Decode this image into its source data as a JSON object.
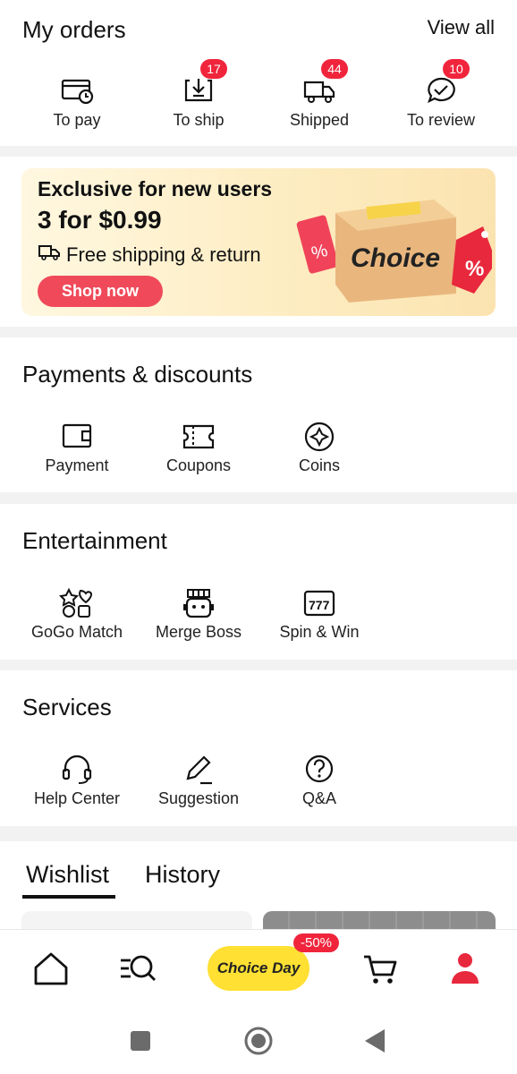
{
  "orders": {
    "title": "My orders",
    "view_all": "View all",
    "items": [
      {
        "label": "To pay",
        "icon": "wallet-clock-icon",
        "badge": ""
      },
      {
        "label": "To ship",
        "icon": "inbox-download-icon",
        "badge": "17"
      },
      {
        "label": "Shipped",
        "icon": "truck-icon",
        "badge": "44"
      },
      {
        "label": "To review",
        "icon": "chat-check-icon",
        "badge": "10"
      }
    ]
  },
  "promo": {
    "line1": "Exclusive for new users",
    "line2": "3 for $0.99",
    "line3": "Free shipping & return",
    "button": "Shop now",
    "brand": "Choice"
  },
  "payments": {
    "title": "Payments & discounts",
    "items": [
      {
        "label": "Payment",
        "icon": "wallet-icon"
      },
      {
        "label": "Coupons",
        "icon": "ticket-icon"
      },
      {
        "label": "Coins",
        "icon": "coin-icon"
      }
    ]
  },
  "entertainment": {
    "title": "Entertainment",
    "items": [
      {
        "label": "GoGo Match",
        "icon": "match-icon"
      },
      {
        "label": "Merge Boss",
        "icon": "robot-icon"
      },
      {
        "label": "Spin & Win",
        "icon": "slot-777-icon"
      }
    ]
  },
  "services": {
    "title": "Services",
    "items": [
      {
        "label": "Help Center",
        "icon": "headset-icon"
      },
      {
        "label": "Suggestion",
        "icon": "pencil-icon"
      },
      {
        "label": "Q&A",
        "icon": "question-bubble-icon"
      }
    ]
  },
  "tabs": {
    "wishlist": "Wishlist",
    "history": "History"
  },
  "bottom_nav": {
    "choice_label": "Choice Day",
    "discount_badge": "-50%"
  },
  "colors": {
    "accent_red": "#f0253c",
    "choice_yellow": "#ffe033",
    "banner_bg": "#fdecc0"
  }
}
